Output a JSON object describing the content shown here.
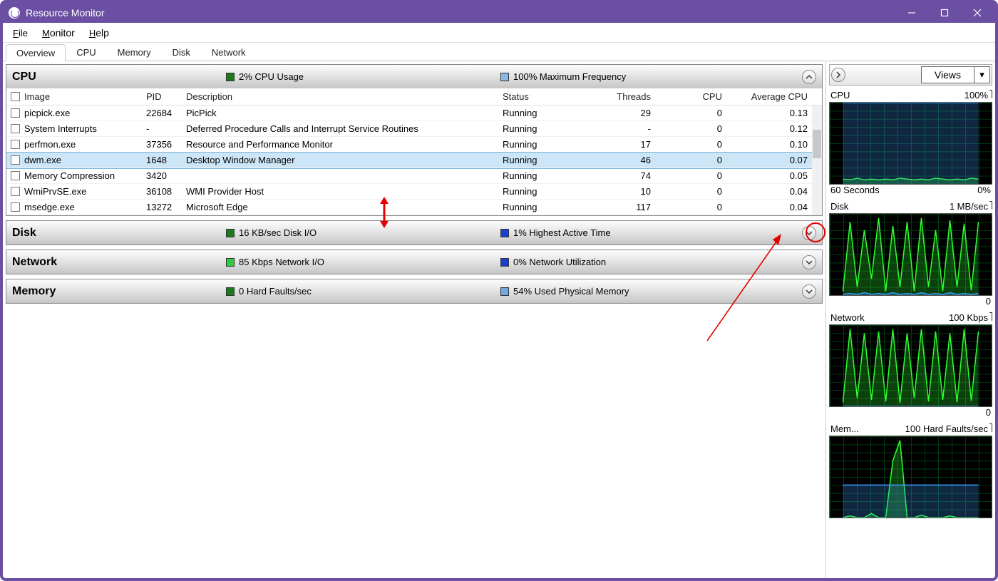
{
  "titlebar": {
    "title": "Resource Monitor"
  },
  "menu": {
    "file": "File",
    "monitor": "Monitor",
    "help": "Help"
  },
  "tabs": {
    "overview": "Overview",
    "cpu": "CPU",
    "memory": "Memory",
    "disk": "Disk",
    "network": "Network"
  },
  "sections": {
    "cpu": {
      "name": "CPU",
      "stat1": "2% CPU Usage",
      "stat2": "100% Maximum Frequency",
      "swatch1": "#1b7a1b",
      "swatch2": "#8ab9e6"
    },
    "disk": {
      "name": "Disk",
      "stat1": "16 KB/sec Disk I/O",
      "stat2": "1% Highest Active Time",
      "swatch1": "#1b7a1b",
      "swatch2": "#1a3fd1"
    },
    "network": {
      "name": "Network",
      "stat1": "85 Kbps Network I/O",
      "stat2": "0% Network Utilization",
      "swatch1": "#2ecc40",
      "swatch2": "#1a3fd1"
    },
    "memory": {
      "name": "Memory",
      "stat1": "0 Hard Faults/sec",
      "stat2": "54% Used Physical Memory",
      "swatch1": "#1b7a1b",
      "swatch2": "#6fa8dc"
    }
  },
  "table": {
    "headers": {
      "image": "Image",
      "pid": "PID",
      "desc": "Description",
      "status": "Status",
      "threads": "Threads",
      "cpu": "CPU",
      "acpu": "Average CPU"
    },
    "rows": [
      {
        "image": "picpick.exe",
        "pid": "22684",
        "desc": "PicPick",
        "status": "Running",
        "threads": "29",
        "cpu": "0",
        "acpu": "0.13"
      },
      {
        "image": "System Interrupts",
        "pid": "-",
        "desc": "Deferred Procedure Calls and Interrupt Service Routines",
        "status": "Running",
        "threads": "-",
        "cpu": "0",
        "acpu": "0.12"
      },
      {
        "image": "perfmon.exe",
        "pid": "37356",
        "desc": "Resource and Performance Monitor",
        "status": "Running",
        "threads": "17",
        "cpu": "0",
        "acpu": "0.10"
      },
      {
        "image": "dwm.exe",
        "pid": "1648",
        "desc": "Desktop Window Manager",
        "status": "Running",
        "threads": "46",
        "cpu": "0",
        "acpu": "0.07",
        "selected": true
      },
      {
        "image": "Memory Compression",
        "pid": "3420",
        "desc": "",
        "status": "Running",
        "threads": "74",
        "cpu": "0",
        "acpu": "0.05"
      },
      {
        "image": "WmiPrvSE.exe",
        "pid": "36108",
        "desc": "WMI Provider Host",
        "status": "Running",
        "threads": "10",
        "cpu": "0",
        "acpu": "0.04"
      },
      {
        "image": "msedge.exe",
        "pid": "13272",
        "desc": "Microsoft Edge",
        "status": "Running",
        "threads": "117",
        "cpu": "0",
        "acpu": "0.04"
      }
    ]
  },
  "views_label": "Views",
  "side": {
    "cpu": {
      "label": "CPU",
      "rlabel": "100%",
      "foot_l": "60 Seconds",
      "foot_r": "0%"
    },
    "disk": {
      "label": "Disk",
      "rlabel": "1 MB/sec",
      "foot_l": "",
      "foot_r": "0"
    },
    "network": {
      "label": "Network",
      "rlabel": "100 Kbps",
      "foot_l": "",
      "foot_r": "0"
    },
    "memory": {
      "label": "Mem...",
      "rlabel": "100 Hard Faults/sec",
      "foot_l": "",
      "foot_r": ""
    }
  },
  "chart_data": [
    {
      "type": "line",
      "title": "CPU",
      "ylim": [
        0,
        100
      ],
      "xlabel": "60 Seconds",
      "ylabel": "%",
      "series": [
        {
          "name": "CPU Usage",
          "color": "#2eff2e",
          "values": [
            6,
            5,
            7,
            5,
            6,
            5,
            6,
            5,
            7,
            6,
            5,
            6,
            5,
            7,
            6,
            5,
            6,
            5,
            7,
            6
          ]
        },
        {
          "name": "Maximum Frequency",
          "color": "#3a9bff",
          "values": [
            100,
            100,
            100,
            100,
            100,
            100,
            100,
            100,
            100,
            100,
            100,
            100,
            100,
            100,
            100,
            100,
            100,
            100,
            100,
            100
          ]
        }
      ]
    },
    {
      "type": "line",
      "title": "Disk",
      "ylim": [
        0,
        1
      ],
      "ylabel": "MB/sec",
      "series": [
        {
          "name": "Disk I/O",
          "color": "#2eff2e",
          "values": [
            0.05,
            0.9,
            0.1,
            0.8,
            0.2,
            0.95,
            0.05,
            0.85,
            0.1,
            0.9,
            0.05,
            0.95,
            0.1,
            0.8,
            0.05,
            0.92,
            0.1,
            0.88,
            0.06,
            0.9
          ]
        },
        {
          "name": "Highest Active",
          "color": "#3a9bff",
          "values": [
            0.01,
            0.02,
            0.01,
            0.03,
            0.01,
            0.02,
            0.01,
            0.03,
            0.01,
            0.02,
            0.01,
            0.03,
            0.01,
            0.02,
            0.01,
            0.03,
            0.01,
            0.02,
            0.01,
            0.02
          ]
        }
      ]
    },
    {
      "type": "line",
      "title": "Network",
      "ylim": [
        0,
        100
      ],
      "ylabel": "Kbps",
      "series": [
        {
          "name": "Network I/O",
          "color": "#2eff2e",
          "values": [
            5,
            95,
            10,
            90,
            8,
            92,
            6,
            95,
            4,
            90,
            10,
            95,
            6,
            92,
            8,
            90,
            5,
            95,
            7,
            92
          ]
        },
        {
          "name": "Utilization",
          "color": "#3a9bff",
          "values": [
            0,
            0,
            0,
            0,
            0,
            0,
            0,
            0,
            0,
            0,
            0,
            0,
            0,
            0,
            0,
            0,
            0,
            0,
            0,
            0
          ]
        }
      ]
    },
    {
      "type": "line",
      "title": "Memory",
      "ylim": [
        0,
        100
      ],
      "ylabel": "Hard Faults/sec",
      "series": [
        {
          "name": "Hard Faults",
          "color": "#2eff2e",
          "values": [
            0,
            2,
            0,
            0,
            5,
            0,
            0,
            70,
            95,
            0,
            0,
            3,
            0,
            0,
            0,
            2,
            0,
            0,
            0,
            0
          ]
        },
        {
          "name": "Used Physical Memory",
          "color": "#3a9bff",
          "values": [
            40,
            40,
            40,
            40,
            40,
            40,
            40,
            40,
            40,
            40,
            40,
            40,
            40,
            40,
            40,
            40,
            40,
            40,
            40,
            40
          ]
        }
      ]
    }
  ]
}
